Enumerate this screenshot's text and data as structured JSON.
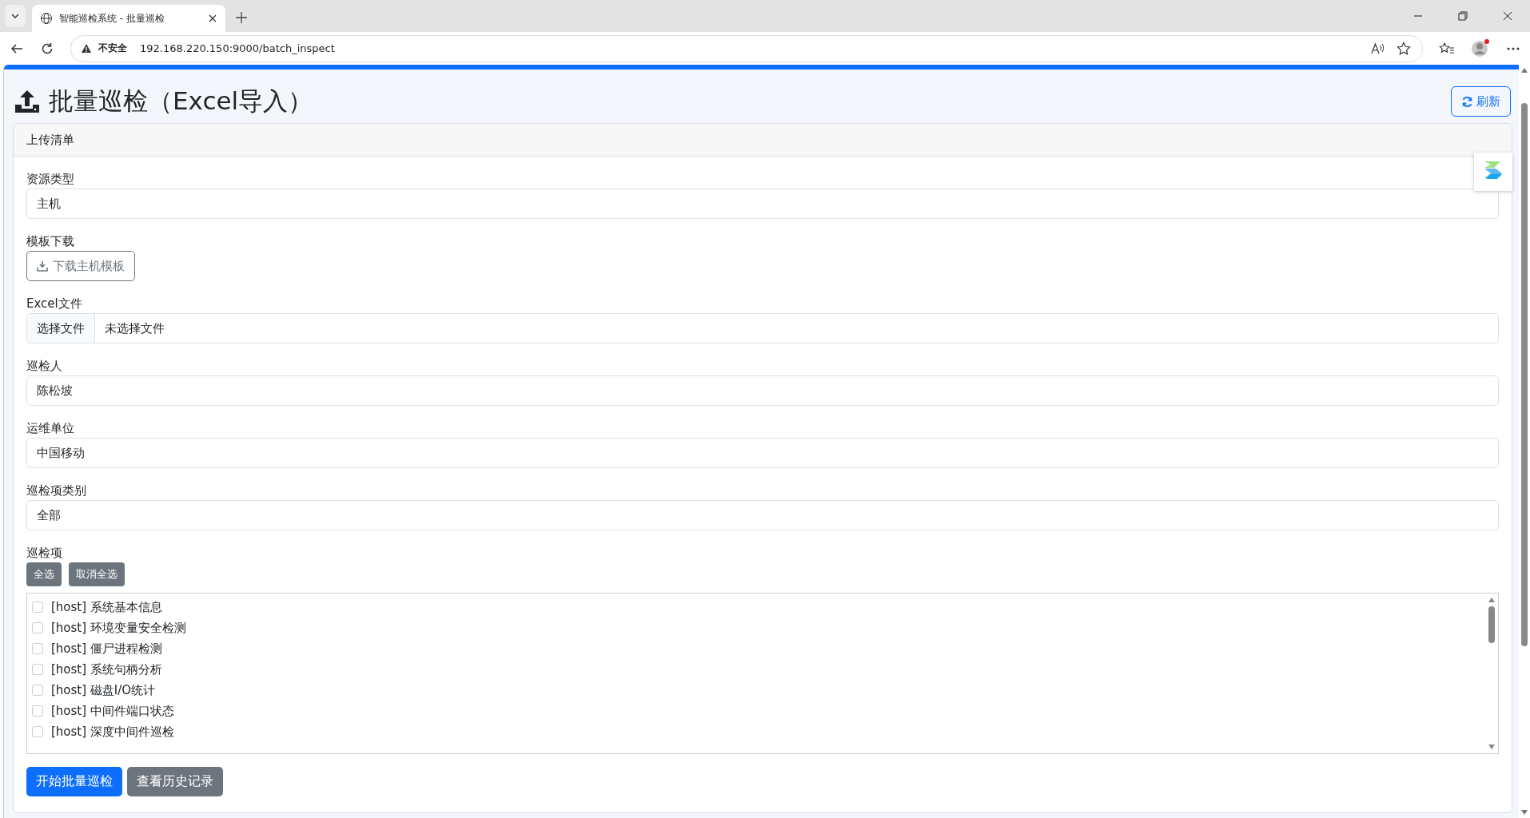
{
  "browser": {
    "tab_title": "智能巡检系统 - 批量巡检",
    "security_label": "不安全",
    "url": "192.168.220.150:9000/batch_inspect"
  },
  "page": {
    "title": "批量巡检（Excel导入）",
    "refresh_button": "刷新"
  },
  "card": {
    "header": "上传清单",
    "fields": [
      {
        "kind": "input",
        "label": "资源类型",
        "value": "主机"
      },
      {
        "kind": "download",
        "label": "模板下载",
        "button": "下载主机模板"
      },
      {
        "kind": "file",
        "label": "Excel文件",
        "button": "选择文件",
        "value": "未选择文件"
      },
      {
        "kind": "input",
        "label": "巡检人",
        "value": "陈松坡"
      },
      {
        "kind": "input",
        "label": "运维单位",
        "value": "中国移动"
      },
      {
        "kind": "input",
        "label": "巡检项类别",
        "value": "全部"
      }
    ],
    "items_label": "巡检项",
    "select_buttons": [
      "全选",
      "取消全选"
    ],
    "items": [
      {
        "label": "[host] 系统基本信息",
        "checked": false
      },
      {
        "label": "[host] 环境变量安全检测",
        "checked": false
      },
      {
        "label": "[host] 僵尸进程检测",
        "checked": false
      },
      {
        "label": "[host] 系统句柄分析",
        "checked": false
      },
      {
        "label": "[host] 磁盘I/O统计",
        "checked": false
      },
      {
        "label": "[host] 中间件端口状态",
        "checked": false
      },
      {
        "label": "[host] 深度中间件巡检",
        "checked": false
      }
    ],
    "actions": [
      {
        "label": "开始批量巡检",
        "kind": "primary"
      },
      {
        "label": "查看历史记录",
        "kind": "secondary"
      }
    ]
  }
}
